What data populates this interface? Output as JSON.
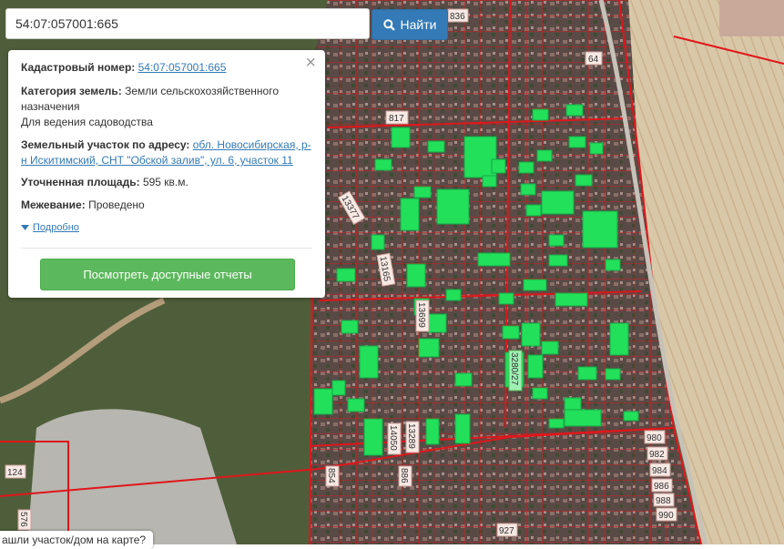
{
  "search": {
    "value": "54:07:057001:665",
    "button_label": "Найти"
  },
  "panel": {
    "cadastral_label": "Кадастровый номер:",
    "cadastral_value": "54:07:057001:665",
    "category_label": "Категория земель:",
    "category_value": "Земли сельскохозяйственного назначения",
    "category_use": "Для ведения садоводства",
    "address_label": "Земельный участок по адресу:",
    "address_value": "обл. Новосибирская, р-н Искитимский, СНТ \"Обской залив\", ул. 6, участок 11",
    "area_label": "Уточненная площадь:",
    "area_value": "595 кв.м.",
    "survey_label": "Межевание:",
    "survey_value": "Проведено",
    "details_label": "Подробно",
    "report_button": "Посмотреть доступные отчеты"
  },
  "map_labels": {
    "l836": "836",
    "l64": "64",
    "l817": "817",
    "l13377": "13377",
    "l13165": "13165",
    "l13699": "13699",
    "l3280": "3280/27",
    "l14050": "14050",
    "l13289": "13289",
    "l854": "854",
    "l886": "886",
    "l927": "927",
    "l124": "124",
    "l576": "576",
    "l980": "980",
    "l982": "982",
    "l984": "984",
    "l986": "986",
    "l988": "988",
    "l990": "990"
  },
  "tip": {
    "text": "ашли участок/дом на карте?"
  },
  "colors": {
    "parcel_line": "#e0161b",
    "selected_parcel": "#22e05a",
    "search_button": "#337ab7",
    "report_button": "#5cb85c"
  }
}
